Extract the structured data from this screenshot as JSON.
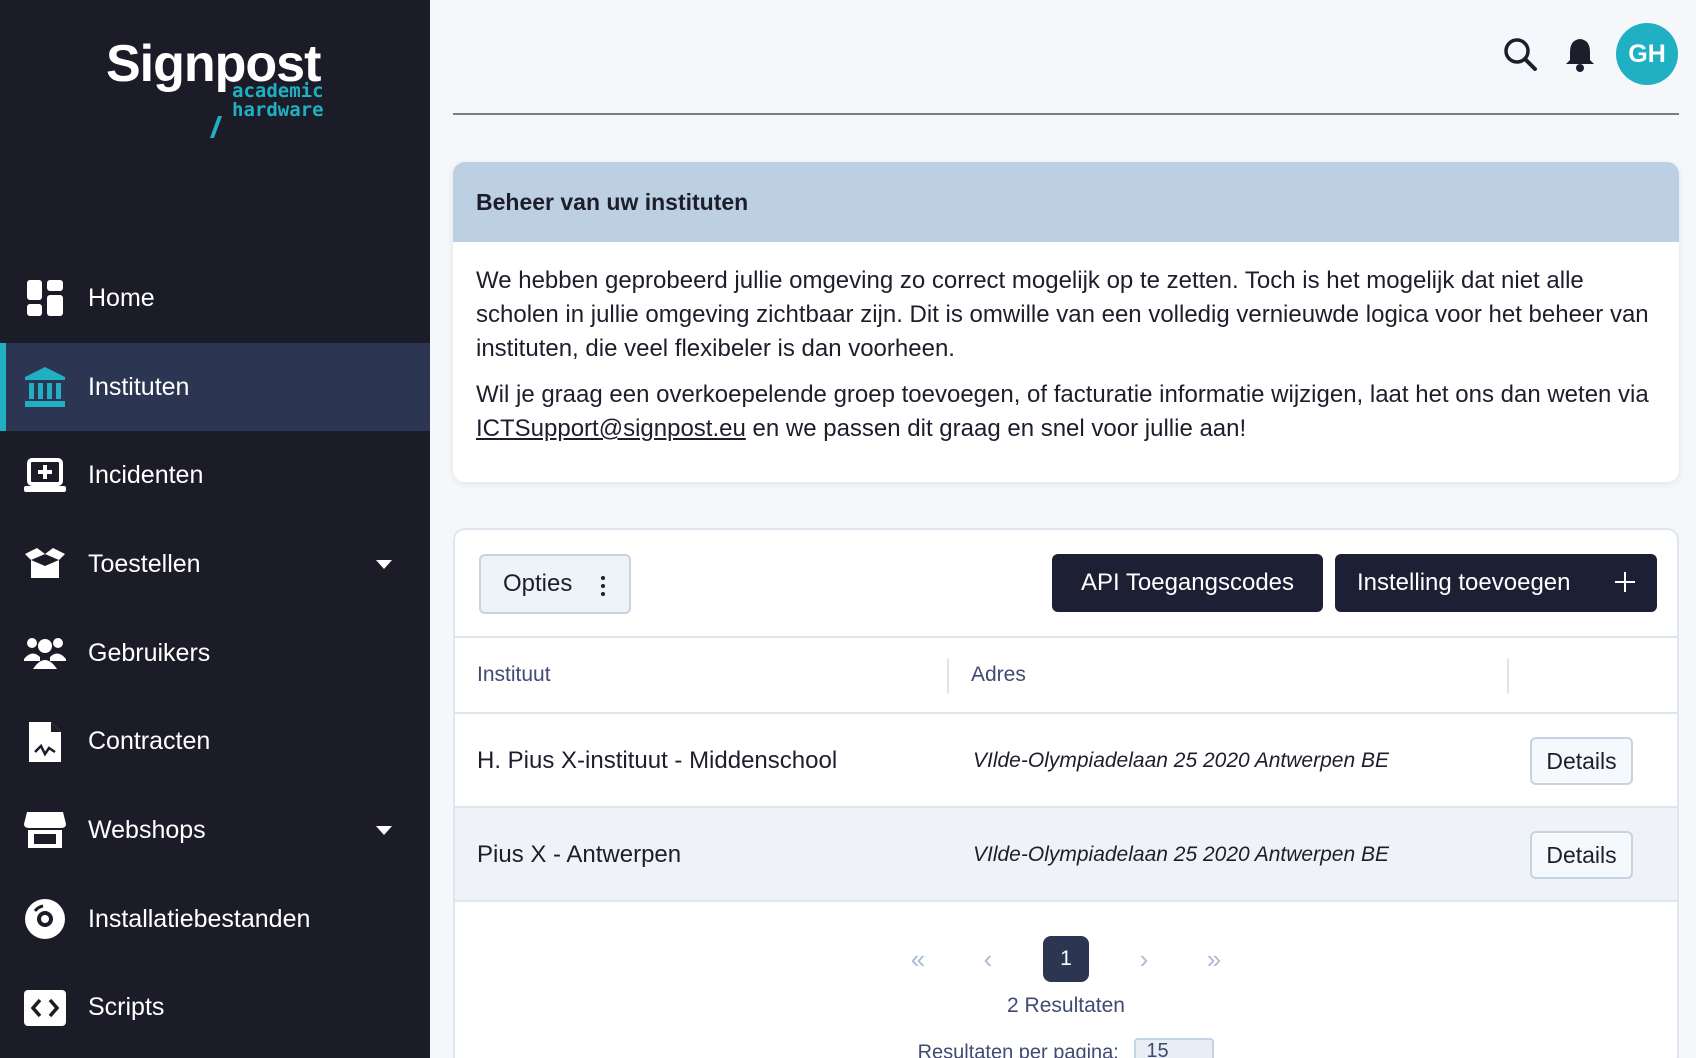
{
  "brand": {
    "name": "Signpost",
    "subtitle_line1": "academic",
    "subtitle_line2": "hardware",
    "accent_color": "#1fb0c4",
    "sidebar_color": "#1b1c27"
  },
  "sidebar": {
    "items": [
      {
        "label": "Home",
        "icon": "dashboard-icon",
        "active": false
      },
      {
        "label": "Instituten",
        "icon": "institution-icon",
        "active": true
      },
      {
        "label": "Incidenten",
        "icon": "laptop-plus-icon",
        "active": false
      },
      {
        "label": "Toestellen",
        "icon": "box-open-icon",
        "active": false,
        "expandable": true
      },
      {
        "label": "Gebruikers",
        "icon": "users-icon",
        "active": false
      },
      {
        "label": "Contracten",
        "icon": "contract-icon",
        "active": false
      },
      {
        "label": "Webshops",
        "icon": "store-icon",
        "active": false,
        "expandable": true
      },
      {
        "label": "Installatiebestanden",
        "icon": "disc-icon",
        "active": false
      },
      {
        "label": "Scripts",
        "icon": "code-icon",
        "active": false
      }
    ]
  },
  "header": {
    "avatar_initials": "GH",
    "icons": [
      "search-icon",
      "bell-icon"
    ]
  },
  "info": {
    "title": "Beheer van uw instituten",
    "paragraph1": "We hebben geprobeerd jullie omgeving zo correct mogelijk op te zetten. Toch is het mogelijk dat niet alle scholen in jullie omgeving zichtbaar zijn. Dit is omwille van een volledig vernieuwde logica voor het beheer van instituten, die veel flexibeler is dan voorheen.",
    "paragraph2_before": "Wil je graag een overkoepelende groep toevoegen, of facturatie informatie wijzigen, laat het ons dan weten via ",
    "email": "ICTSupport@signpost.eu",
    "paragraph2_after": " en we passen dit graag en snel voor jullie aan!"
  },
  "toolbar": {
    "options_label": "Opties",
    "api_label": "API Toegangscodes",
    "add_label": "Instelling toevoegen"
  },
  "table": {
    "columns": [
      "Instituut",
      "Adres",
      ""
    ],
    "rows": [
      {
        "name": "H. Pius X-instituut - Middenschool",
        "address": "VIlde-Olympiadelaan 25 2020 Antwerpen BE",
        "action": "Details"
      },
      {
        "name": "Pius X - Antwerpen",
        "address": "VIlde-Olympiadelaan 25 2020 Antwerpen BE",
        "action": "Details"
      }
    ]
  },
  "pagination": {
    "first": "«",
    "prev": "‹",
    "current_page": "1",
    "next": "›",
    "last": "»",
    "results": "2 Resultaten",
    "per_page_label": "Resultaten per pagina:",
    "per_page_value": "15"
  }
}
